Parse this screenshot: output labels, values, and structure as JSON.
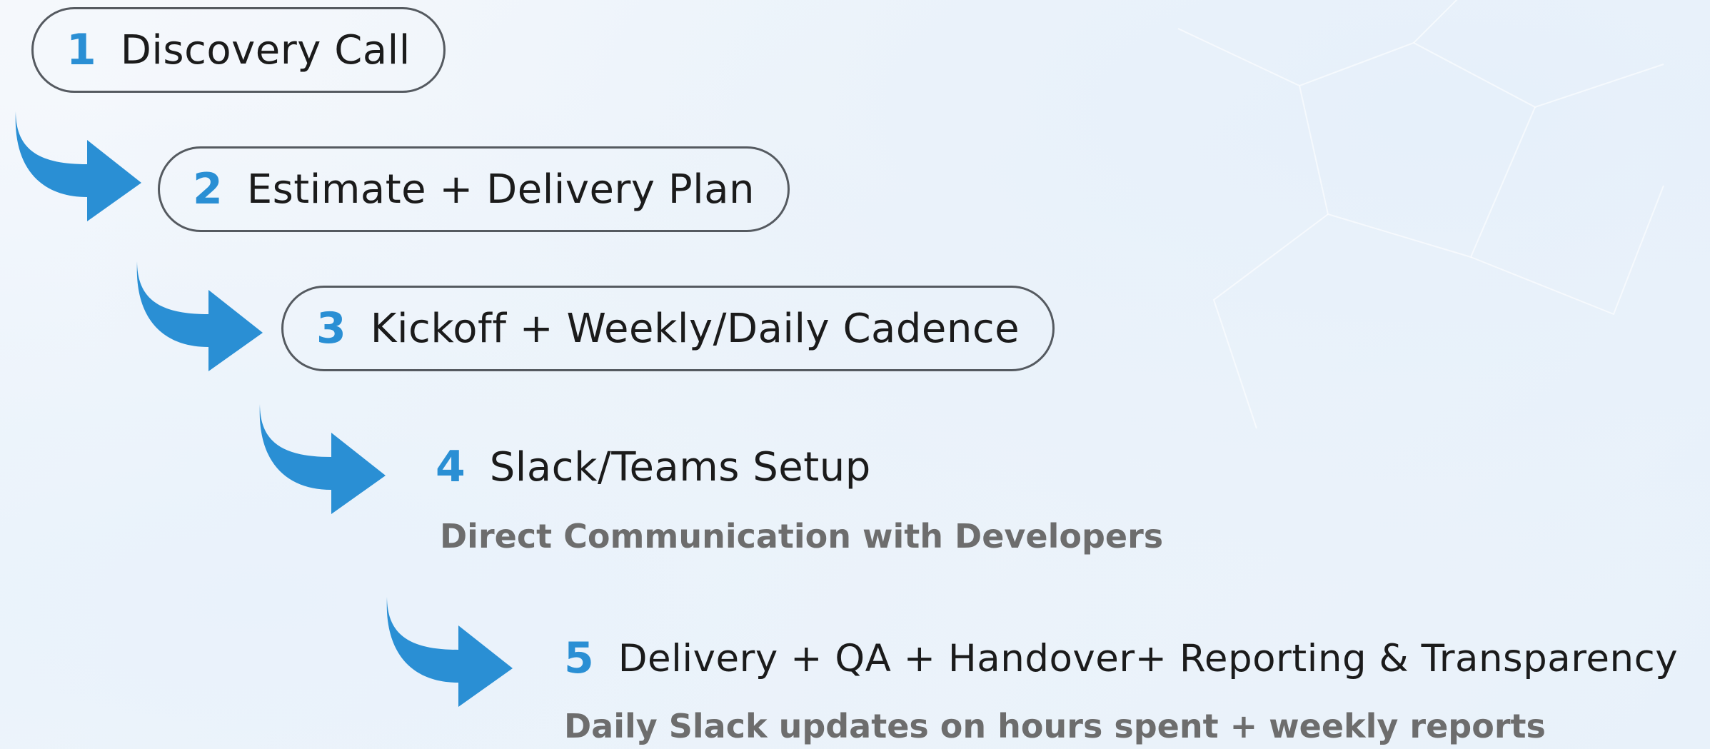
{
  "colors": {
    "accent": "#2a8fd4",
    "text": "#1b1b1b",
    "subtext": "#6d6d6d",
    "border": "#555a60"
  },
  "steps": [
    {
      "number": "1",
      "label": "Discovery Call"
    },
    {
      "number": "2",
      "label": "Estimate + Delivery Plan"
    },
    {
      "number": "3",
      "label": "Kickoff + Weekly/Daily Cadence"
    },
    {
      "number": "4",
      "label": "Slack/Teams Setup",
      "sub": "Direct Communication with Developers"
    },
    {
      "number": "5",
      "label": "Delivery + QA + Handover+ Reporting & Transparency",
      "sub": "Daily Slack updates on hours spent + weekly reports"
    }
  ],
  "icons": {
    "connector": "curved-arrow-icon"
  }
}
